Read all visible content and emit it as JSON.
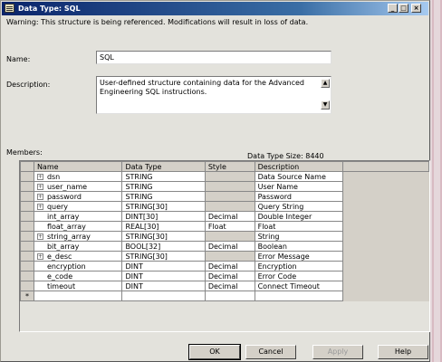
{
  "window": {
    "title": "Data Type: SQL",
    "controls": {
      "minimize": "_",
      "maximize": "□",
      "close": "×"
    }
  },
  "warning": "Warning: This structure is being referenced.  Modifications will result in loss of data.",
  "name": {
    "label": "Name:",
    "value": "SQL"
  },
  "description": {
    "label": "Description:",
    "value": "User-defined structure containing data for the Advanced Engineering SQL instructions."
  },
  "members": {
    "label": "Members:",
    "size_text": "Data Type Size: 8440",
    "headers": [
      "Name",
      "Data Type",
      "Style",
      "Description"
    ],
    "rows": [
      {
        "expand": true,
        "name": "dsn",
        "type": "STRING",
        "style": "",
        "desc": "Data Source Name"
      },
      {
        "expand": true,
        "name": "user_name",
        "type": "STRING",
        "style": "",
        "desc": "User Name"
      },
      {
        "expand": true,
        "name": "password",
        "type": "STRING",
        "style": "",
        "desc": "Password"
      },
      {
        "expand": true,
        "name": "query",
        "type": "STRING[30]",
        "style": "",
        "desc": "Query String"
      },
      {
        "expand": false,
        "name": "int_array",
        "type": "DINT[30]",
        "style": "Decimal",
        "desc": "Double Integer"
      },
      {
        "expand": false,
        "name": "float_array",
        "type": "REAL[30]",
        "style": "Float",
        "desc": "Float"
      },
      {
        "expand": true,
        "name": "string_array",
        "type": "STRING[30]",
        "style": "",
        "desc": "String"
      },
      {
        "expand": false,
        "name": "bit_array",
        "type": "BOOL[32]",
        "style": "Decimal",
        "desc": "Boolean"
      },
      {
        "expand": true,
        "name": "e_desc",
        "type": "STRING[30]",
        "style": "",
        "desc": "Error Message"
      },
      {
        "expand": false,
        "name": "encryption",
        "type": "DINT",
        "style": "Decimal",
        "desc": "Encryption"
      },
      {
        "expand": false,
        "name": "e_code",
        "type": "DINT",
        "style": "Decimal",
        "desc": "Error Code"
      },
      {
        "expand": false,
        "name": "timeout",
        "type": "DINT",
        "style": "Decimal",
        "desc": "Connect Timeout"
      }
    ],
    "new_row_marker": "*"
  },
  "buttons": {
    "ok": "OK",
    "cancel": "Cancel",
    "apply": "Apply",
    "help": "Help"
  }
}
